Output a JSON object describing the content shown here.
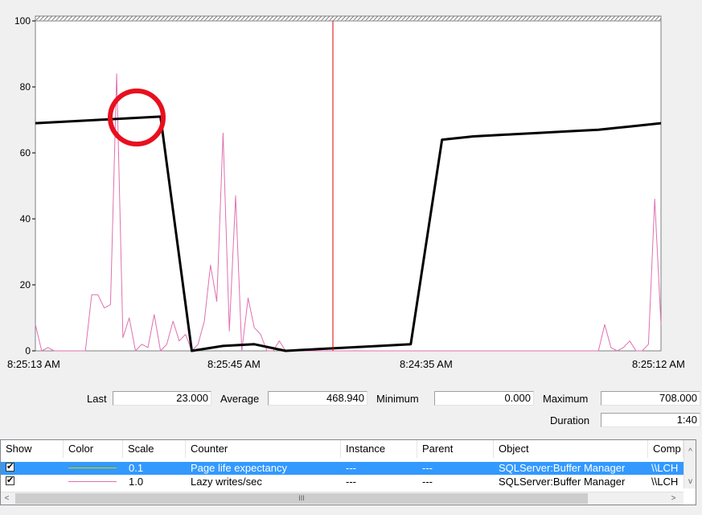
{
  "chart_data": {
    "type": "line",
    "ylim": [
      0,
      100
    ],
    "y_ticks": [
      "0",
      "20",
      "40",
      "60",
      "80",
      "100"
    ],
    "x_tick_labels": [
      "8:25:13 AM",
      "8:25:45 AM",
      "8:24:35 AM",
      "8:25:12 AM"
    ],
    "series": [
      {
        "color": "#000000",
        "x": [
          0,
          10,
          20,
          25,
          30,
          35,
          40,
          45,
          50,
          55,
          60,
          65,
          70,
          75,
          80,
          85,
          90,
          95,
          100
        ],
        "values": [
          69,
          70,
          71,
          0,
          1.5,
          2,
          0,
          0.5,
          1,
          1.5,
          2,
          64,
          65,
          65.5,
          66,
          66.5,
          67,
          68,
          69
        ]
      },
      {
        "color": "#e070b0",
        "x": [
          0,
          1,
          2,
          3,
          5,
          8,
          9,
          10,
          11,
          12,
          13,
          14,
          15,
          16,
          17,
          18,
          19,
          20,
          21,
          22,
          23,
          24,
          25,
          26,
          27,
          28,
          29,
          30,
          31,
          32,
          33,
          34,
          35,
          36,
          37,
          38,
          39,
          40,
          41,
          42,
          43,
          44,
          45,
          46,
          47,
          48,
          50,
          52,
          53,
          54,
          55,
          56,
          58,
          60,
          62,
          64,
          66,
          68,
          70,
          72,
          80,
          90,
          91,
          92,
          93,
          94,
          95,
          96,
          97,
          98,
          99,
          100
        ],
        "values": [
          8,
          0,
          1,
          0,
          0,
          0,
          17,
          17,
          13,
          14,
          84,
          4,
          10,
          0,
          2,
          1,
          11,
          0,
          2,
          9,
          3,
          5,
          0,
          2,
          9,
          26,
          15,
          66,
          6,
          47,
          0,
          16,
          7,
          5,
          0,
          0,
          3,
          0,
          0,
          0,
          0,
          0,
          0,
          0,
          0,
          0,
          0,
          0,
          0,
          0,
          0,
          0,
          0,
          0,
          0,
          0,
          0,
          0,
          0,
          0,
          0,
          0,
          8,
          1,
          0,
          1,
          3,
          0,
          0,
          2,
          46,
          8
        ]
      }
    ],
    "annotations": [
      "red circle highlighting the counter peak near 70"
    ]
  },
  "stats": {
    "last_label": "Last",
    "last_value": "23.000",
    "average_label": "Average",
    "average_value": "468.940",
    "minimum_label": "Minimum",
    "minimum_value": "0.000",
    "maximum_label": "Maximum",
    "maximum_value": "708.000",
    "duration_label": "Duration",
    "duration_value": "1:40"
  },
  "table": {
    "headers": [
      "Show",
      "Color",
      "Scale",
      "Counter",
      "Instance",
      "Parent",
      "Object",
      "Comp"
    ],
    "rows": [
      {
        "color": "#d8d000",
        "scale": "0.1",
        "counter": "Page life expectancy",
        "instance": "---",
        "parent": "---",
        "object": "SQLServer:Buffer Manager",
        "computer": "\\\\LCH",
        "checked": true
      },
      {
        "color": "#e070b0",
        "scale": "1.0",
        "counter": "Lazy writes/sec",
        "instance": "---",
        "parent": "---",
        "object": "SQLServer:Buffer Manager",
        "computer": "\\\\LCH",
        "checked": true
      }
    ]
  },
  "scrollbar": {
    "thumb_grip": "III",
    "up": "^",
    "down": "v",
    "left": "<",
    "right": ">"
  },
  "colors": {
    "time_bar": "#dd0000",
    "annotation": "#e8101e"
  }
}
